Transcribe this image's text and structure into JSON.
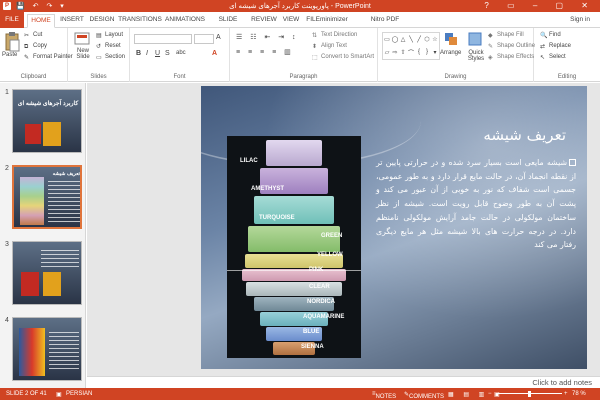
{
  "titlebar": {
    "app_icon": "P",
    "quick_access": "💾 ↶ ↷ ▾",
    "title": "پاورپوینت کاربرد آجرهای شیشه ای - PowerPoint",
    "window_controls": "? ▭ – ▢ ✕"
  },
  "tabs": [
    {
      "label": "FILE"
    },
    {
      "label": "HOME"
    },
    {
      "label": "INSERT"
    },
    {
      "label": "DESIGN"
    },
    {
      "label": "TRANSITIONS"
    },
    {
      "label": "ANIMATIONS"
    },
    {
      "label": "SLIDE SHOW"
    },
    {
      "label": "REVIEW"
    },
    {
      "label": "VIEW"
    },
    {
      "label": "FILEminimizer"
    },
    {
      "label": "Nitro PDF Professional"
    }
  ],
  "active_tab": "HOME",
  "signin": "Sign in",
  "ribbon": {
    "clipboard": {
      "paste": "Paste",
      "cut": "Cut",
      "copy": "Copy",
      "format_painter": "Format Painter",
      "label": "Clipboard"
    },
    "slides": {
      "new_slide": "New Slide",
      "layout": "Layout",
      "reset": "Reset",
      "section": "Section",
      "label": "Slides"
    },
    "font": {
      "label": "Font",
      "bold": "B",
      "italic": "I",
      "underline": "U",
      "strike": "S",
      "shadow": "abc",
      "font_color": "A"
    },
    "paragraph": {
      "text_direction": "Text Direction",
      "align_text": "Align Text",
      "smartart": "Convert to SmartArt",
      "label": "Paragraph"
    },
    "drawing": {
      "arrange": "Arrange",
      "quick_styles": "Quick Styles",
      "shape_fill": "Shape Fill",
      "shape_outline": "Shape Outline",
      "shape_effects": "Shape Effects",
      "label": "Drawing"
    },
    "editing": {
      "find": "Find",
      "replace": "Replace",
      "select": "Select",
      "label": "Editing"
    }
  },
  "thumbnails": [
    {
      "number": "1",
      "title": "کاربرد آجرهای شیشه ای"
    },
    {
      "number": "2",
      "title": "تعریف شیشه"
    },
    {
      "number": "3",
      "title": ""
    },
    {
      "number": "4",
      "title": ""
    }
  ],
  "slide": {
    "title": "تعریف شیشه",
    "body": "شیشه مایعی است بسیار سرد شده و در حرارتی پایین تر از نقطه انجماد آن، در حالت مایع قرار دارد و به طور عمومی، جسمی است شفاف که نور به خوبی از آن عبور می کند و پشت آن به طور وضوح قابل رویت است. شیشه از نظر ساختمان مولکولی در حالت جامد آرایش مولکولی نامنظم دارد. در درجه حرارت های بالا شیشه مثل هر مایع دیگری رفتار می کند",
    "glass_labels": [
      "LILAC",
      "AMETHYST",
      "TURQUOISE",
      "GREEN",
      "YELLOW",
      "PINK",
      "CLEAR",
      "NORDICA",
      "AQUAMARINE",
      "BLUE",
      "SIENNA"
    ]
  },
  "notes_placeholder": "Click to add notes",
  "status": {
    "slide_of": "SLIDE 2 OF 41",
    "language": "PERSIAN",
    "notes": "NOTES",
    "comments": "COMMENTS",
    "zoom": "78 %"
  },
  "colors": {
    "accent": "#d04423",
    "selected_thumb": "#e0743b"
  }
}
